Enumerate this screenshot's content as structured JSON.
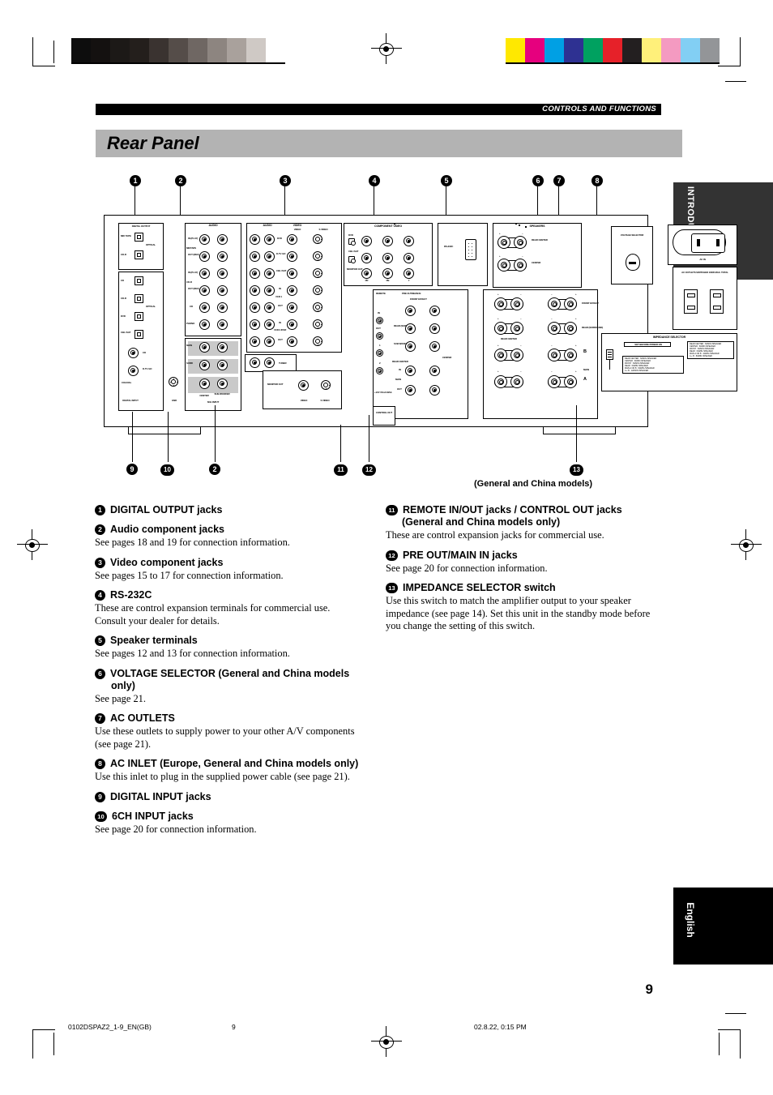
{
  "header": {
    "chapter": "CONTROLS AND FUNCTIONS",
    "title": "Rear Panel"
  },
  "side_tabs": {
    "introduction": "INTRODUCTION",
    "english": "English"
  },
  "diagram": {
    "models_note": "(General and China models)",
    "callouts_top": [
      "1",
      "2",
      "3",
      "4",
      "5",
      "6",
      "7",
      "8"
    ],
    "callouts_bottom": [
      "9",
      "10",
      "2",
      "11",
      "12",
      "13"
    ],
    "labels": {
      "digital_output": "DIGITAL OUTPUT",
      "digital_input": "DIGITAL INPUT",
      "md_tape": "MD/ TAPE",
      "cdr": "CD-R",
      "optical": "OPTICAL",
      "cd": "CD",
      "dvd": "DVD",
      "cbl_sat": "CBL /SAT",
      "dtv_ld": "D-TV /LD",
      "coaxial": "COAXIAL",
      "gnd": "GND",
      "audio": "AUDIO",
      "in_play": "IN (PLAY)",
      "out_rec": "OUT (REC)",
      "mdtape_grp": "MD/TAPE",
      "cdr_grp": "CD-R",
      "cd_grp": "CD",
      "phono": "PHONO",
      "main_6ch": "MAIN",
      "surr_6ch": "SURR",
      "center_6ch": "CENTER",
      "subwoofer_6ch": "SUB WOOFER",
      "sixch_input": "6CH INPUT",
      "video": "VIDEO",
      "s_video": "S VIDEO",
      "component_video": "COMPONENT VIDEO",
      "vcr1": "VCR 1",
      "vcr2_dvr": "VCR 2 /DVR",
      "in": "IN",
      "out": "OUT",
      "tuner": "TUNER",
      "monitor_out": "MONITOR OUT",
      "pr": "PR",
      "pb": "PB",
      "y": "Y",
      "rs232c": "RS-232C",
      "speakers": "SPEAKERS",
      "rear_center": "REAR CENTER",
      "center": "CENTER",
      "front_effect": "FRONT EFFECT",
      "rear_surround": "REAR (SURROUND)",
      "main": "MAIN",
      "spk_a": "A",
      "spk_b": "B",
      "plus": "+",
      "minus": "–",
      "remote": "REMOTE",
      "pre_out_main_in": "PRE OUT/MAIN IN",
      "sub_woofer": "SUB WOOFER",
      "control_out": "CONTROL OUT",
      "plus12v": "+12V 15mA MAX.",
      "ch_1": "1",
      "ch_2": "2",
      "voltage_selector": "VOLTAGE SELECTOR",
      "ac_in": "AC IN",
      "ac_outlets": "AC OUTLETS SWITCHED 100W MAX. TOTAL",
      "impedance_selector": "IMPEDANCE SELECTOR",
      "impedance_note": "SET BEFORE POWER ON"
    },
    "impedance_table_left": [
      "REAR CENTER  : 6ΩMIN./SPEAKER",
      "CENTER           : 6ΩMIN./SPEAKER",
      "FRONT             : 6ΩMIN./SPEAKER",
      "REAR               : 6ΩMIN./SPEAKER",
      "MAIN  A OR B  : 6ΩMIN./SPEAKER",
      "A + B : 12ΩMIN./SPEAKER"
    ],
    "impedance_table_right": [
      "REAR CENTER : 6ΩMIN./SPEAKER",
      "CENTER           : 6ΩMIN./SPEAKER",
      "FRONT             : 6ΩMIN./SPEAKER",
      "REAR               : 6ΩMIN./SPEAKER",
      "MAIN A OR B  : 4ΩMIN./SPEAKER",
      "A + B : 8ΩMIN./SPEAKER"
    ]
  },
  "left_column": [
    {
      "num": "1",
      "heading": "DIGITAL OUTPUT jacks",
      "body": ""
    },
    {
      "num": "2",
      "heading": "Audio component jacks",
      "body": "See pages 18 and 19 for connection information."
    },
    {
      "num": "3",
      "heading": "Video component jacks",
      "body": "See pages 15 to 17 for connection information."
    },
    {
      "num": "4",
      "heading": "RS-232C",
      "body": "These are control expansion terminals for commercial use. Consult your dealer for details."
    },
    {
      "num": "5",
      "heading": "Speaker terminals",
      "body": "See pages 12 and 13 for connection information."
    },
    {
      "num": "6",
      "heading": "VOLTAGE SELECTOR (General and China models only)",
      "body": "See page 21."
    },
    {
      "num": "7",
      "heading": "AC OUTLETS",
      "body": "Use these outlets to supply power to your other A/V components (see page 21)."
    },
    {
      "num": "8",
      "heading": "AC INLET (Europe, General and China models only)",
      "body": "Use this inlet to plug in the supplied power cable (see page 21)."
    },
    {
      "num": "9",
      "heading": "DIGITAL INPUT jacks",
      "body": ""
    },
    {
      "num": "10",
      "heading": "6CH INPUT jacks",
      "body": "See page 20 for connection information."
    }
  ],
  "right_column": [
    {
      "num": "11",
      "heading": "REMOTE IN/OUT jacks / CONTROL OUT jacks (General and China models only)",
      "body": "These are control expansion jacks for commercial use."
    },
    {
      "num": "12",
      "heading": "PRE OUT/MAIN IN jacks",
      "body": "See page 20 for connection information."
    },
    {
      "num": "13",
      "heading": "IMPEDANCE SELECTOR switch",
      "body": "Use this switch to match the amplifier output to your speaker impedance (see page 14). Set this unit in the standby mode before you change the setting of this switch."
    }
  ],
  "page_number": "9",
  "footer": {
    "file": "0102DSPAZ2_1-9_EN(GB)",
    "page": "9",
    "date": "02.8.22, 0:15 PM"
  },
  "colors": {
    "title_bar": "#b3b3b3",
    "chapter_bar": "#000000",
    "tab_intro": "#333333",
    "tab_english": "#000000",
    "color_bar_patches": [
      "#ffe800",
      "#e6007e",
      "#00a0e4",
      "#2e3192",
      "#00a160",
      "#e62129",
      "#231f20",
      "#fff07a",
      "#f49ac1",
      "#82cff4",
      "#939598"
    ],
    "gray_ramp": [
      "#0d0d0d",
      "#141110",
      "#1c1917",
      "#241f1c",
      "#3a3330",
      "#554d49",
      "#6f6763",
      "#8d8580",
      "#a9a19c",
      "#cfc9c5",
      "#ffffff"
    ]
  }
}
